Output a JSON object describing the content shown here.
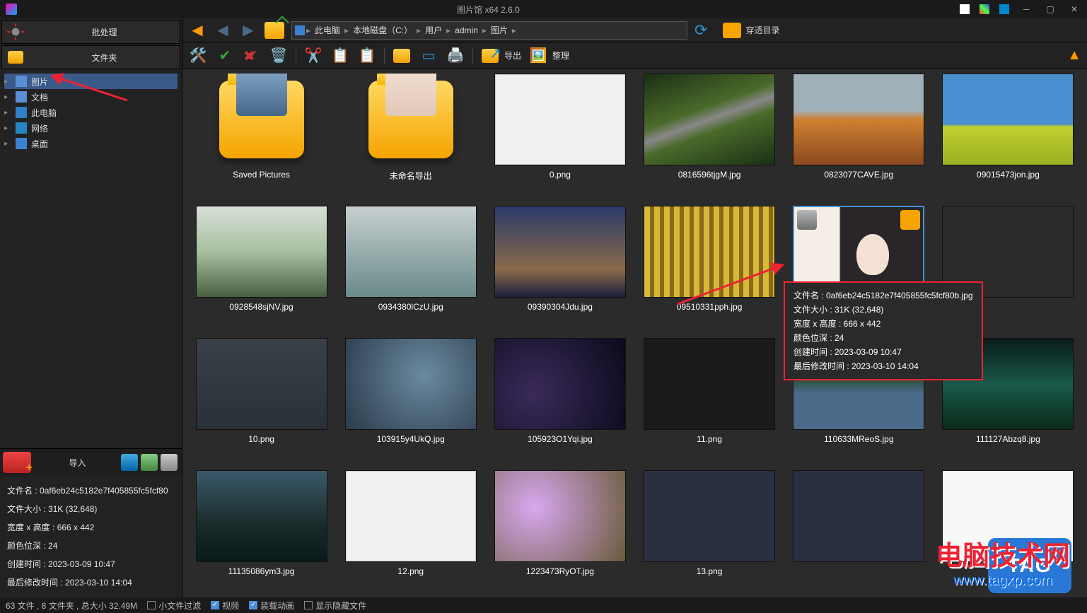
{
  "app": {
    "title": "图片馆 x64 2.6.0"
  },
  "sidebar": {
    "batch_label": "批处理",
    "folder_label": "文件夹",
    "tree": [
      {
        "label": "图片",
        "selected": true
      },
      {
        "label": "文档"
      },
      {
        "label": "此电脑"
      },
      {
        "label": "网络"
      },
      {
        "label": "桌面"
      }
    ],
    "import_label": "导入"
  },
  "path": {
    "segments": [
      "此电脑",
      "本地磁盘（C:）",
      "用户",
      "admin",
      "图片"
    ]
  },
  "penetrate_label": "穿透目录",
  "toolbar": {
    "export_label": "导出",
    "arrange_label": "整理"
  },
  "info": {
    "name_label": "文件名",
    "name_value": "0af6eb24c5182e7f405855fc5fcf80",
    "size_label": "文件大小",
    "size_value": "31K (32,648)",
    "dim_label": "宽度 x 高度",
    "dim_value": "666 x 442",
    "depth_label": "颜色位深",
    "depth_value": "24",
    "ctime_label": "创建时间",
    "ctime_value": "2023-03-09 10:47",
    "mtime_label": "最后修改时间",
    "mtime_value": "2023-03-10 14:04"
  },
  "tooltip": {
    "filename": "文件名 : 0af6eb24c5182e7f405855fc5fcf80b.jpg",
    "filesize": "文件大小 : 31K (32,648)",
    "dim": "宽度 x 高度 : 666 x 442",
    "depth": "颜色位深 : 24",
    "ctime": "创建时间 : 2023-03-09 10:47",
    "mtime": "最后修改时间 : 2023-03-10 14:04"
  },
  "thumbs": [
    {
      "name": "Saved Pictures",
      "type": "folder",
      "inner": "photos"
    },
    {
      "name": "未命名导出",
      "type": "folder",
      "inner": "person"
    },
    {
      "name": "0.png",
      "cls": "sc-doc"
    },
    {
      "name": "0816596tjgM.jpg",
      "cls": "sc-road"
    },
    {
      "name": "0823077CAVE.jpg",
      "cls": "sc-autumn"
    },
    {
      "name": "09015473jon.jpg",
      "cls": "sc-field"
    },
    {
      "name": "0928548sjNV.jpg",
      "cls": "sc-fog"
    },
    {
      "name": "0934380lCzU.jpg",
      "cls": "sc-river"
    },
    {
      "name": "09390304Jdu.jpg",
      "cls": "sc-bridge"
    },
    {
      "name": "09510331pph.jpg",
      "cls": "sc-slats"
    },
    {
      "name": "0af6eb24c…",
      "cls": "sc-girl",
      "selected": true,
      "hover": true
    },
    {
      "name": "",
      "cls": "sc-tiles"
    },
    {
      "name": "10.png",
      "cls": "sc-uieditor"
    },
    {
      "name": "103915y4UkQ.jpg",
      "cls": "sc-blur"
    },
    {
      "name": "105923O1Yqi.jpg",
      "cls": "sc-galaxy"
    },
    {
      "name": "11.png",
      "cls": "sc-dark"
    },
    {
      "name": "110633MReoS.jpg",
      "cls": "sc-lake"
    },
    {
      "name": "111127Abzq8.jpg",
      "cls": "sc-aurora"
    },
    {
      "name": "11135086ym3.jpg",
      "cls": "sc-sea"
    },
    {
      "name": "12.png",
      "cls": "sc-doc"
    },
    {
      "name": "1223473RyOT.jpg",
      "cls": "sc-flowers"
    },
    {
      "name": "13.png",
      "cls": "sc-editor"
    },
    {
      "name": "",
      "cls": "sc-editor"
    },
    {
      "name": "",
      "cls": "sc-editor2"
    }
  ],
  "status": {
    "summary": "63 文件 , 8 文件夹 , 总大小 32.49M",
    "filter_small": "小文件过滤",
    "video": "视频",
    "anim": "装载动画",
    "hidden": "显示隐藏文件"
  },
  "watermark": {
    "line1": "电脑技术网",
    "line2": "www.tagxp.com",
    "tag": "TAG"
  }
}
